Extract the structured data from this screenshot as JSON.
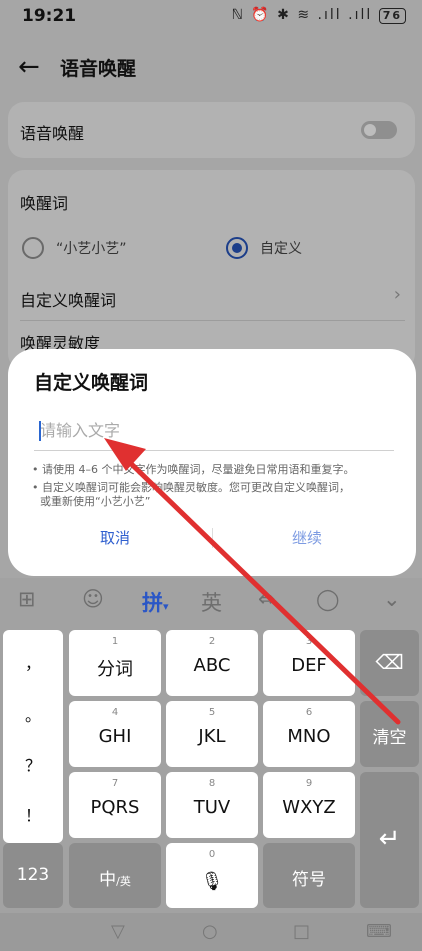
{
  "status_bar": {
    "time": "19:21",
    "icons": "ℕ ⏰ ✱ ≋ .ıll .ıll",
    "battery": "76"
  },
  "header": {
    "title": "语音唤醒"
  },
  "voice_wake": {
    "label": "语音唤醒",
    "toggle_on": false
  },
  "wake_word": {
    "section_label": "唤醒词",
    "options": [
      {
        "label": "“小艺小艺”",
        "selected": false
      },
      {
        "label": "自定义",
        "selected": true
      }
    ],
    "custom_row_label": "自定义唤醒词",
    "sensitivity_label": "唤醒灵敏度"
  },
  "dialog": {
    "title": "自定义唤醒词",
    "input_placeholder": "请输入文字",
    "input_value": "",
    "hint_1": "• 请使用 4–6 个中文字作为唤醒词，尽量避免日常用语和重复字。",
    "hint_2": "• 自定义唤醒词可能会影响唤醒灵敏度。您可更改自定义唤醒词，",
    "hint_3": "或重新使用“小艺小艺”",
    "cancel_label": "取消",
    "continue_label": "继续"
  },
  "keyboard": {
    "toolbar": {
      "pinyin": "拼",
      "english": "英"
    },
    "punct": [
      "，",
      "。",
      "？",
      "！"
    ],
    "rows": [
      [
        {
          "num": "1",
          "label": "分词"
        },
        {
          "num": "2",
          "label": "ABC"
        },
        {
          "num": "3",
          "label": "DEF"
        }
      ],
      [
        {
          "num": "4",
          "label": "GHI"
        },
        {
          "num": "5",
          "label": "JKL"
        },
        {
          "num": "6",
          "label": "MNO"
        }
      ],
      [
        {
          "num": "7",
          "label": "PQRS"
        },
        {
          "num": "8",
          "label": "TUV"
        },
        {
          "num": "9",
          "label": "WXYZ"
        }
      ]
    ],
    "num_key": "123",
    "lang_key": "中",
    "space_num": "0",
    "symbol_key": "符号",
    "clear_key": "清空"
  },
  "colors": {
    "accent": "#2f5fcf",
    "arrow": "#e03030"
  }
}
